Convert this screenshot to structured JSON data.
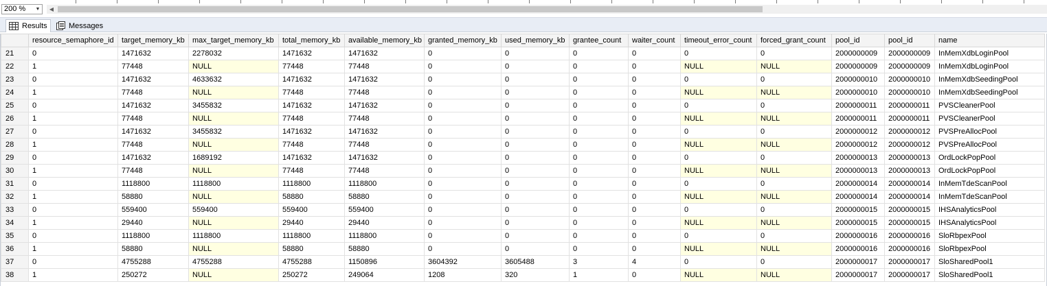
{
  "toolbar": {
    "zoom_value": "200 %"
  },
  "tabs": [
    {
      "label": "Results",
      "icon": "grid-icon",
      "active": true
    },
    {
      "label": "Messages",
      "icon": "messages-icon",
      "active": false
    }
  ],
  "grid": {
    "columns": [
      "resource_semaphore_id",
      "target_memory_kb",
      "max_target_memory_kb",
      "total_memory_kb",
      "available_memory_kb",
      "granted_memory_kb",
      "used_memory_kb",
      "grantee_count",
      "waiter_count",
      "timeout_error_count",
      "forced_grant_count",
      "pool_id",
      "pool_id",
      "name"
    ],
    "null_color": "#ffffe1",
    "rows": [
      [
        "21",
        "0",
        "1471632",
        "2278032",
        "1471632",
        "1471632",
        "0",
        "0",
        "0",
        "0",
        "0",
        "0",
        "2000000009",
        "2000000009",
        "InMemXdbLoginPool"
      ],
      [
        "22",
        "1",
        "77448",
        "NULL",
        "77448",
        "77448",
        "0",
        "0",
        "0",
        "0",
        "NULL",
        "NULL",
        "2000000009",
        "2000000009",
        "InMemXdbLoginPool"
      ],
      [
        "23",
        "0",
        "1471632",
        "4633632",
        "1471632",
        "1471632",
        "0",
        "0",
        "0",
        "0",
        "0",
        "0",
        "2000000010",
        "2000000010",
        "InMemXdbSeedingPool"
      ],
      [
        "24",
        "1",
        "77448",
        "NULL",
        "77448",
        "77448",
        "0",
        "0",
        "0",
        "0",
        "NULL",
        "NULL",
        "2000000010",
        "2000000010",
        "InMemXdbSeedingPool"
      ],
      [
        "25",
        "0",
        "1471632",
        "3455832",
        "1471632",
        "1471632",
        "0",
        "0",
        "0",
        "0",
        "0",
        "0",
        "2000000011",
        "2000000011",
        "PVSCleanerPool"
      ],
      [
        "26",
        "1",
        "77448",
        "NULL",
        "77448",
        "77448",
        "0",
        "0",
        "0",
        "0",
        "NULL",
        "NULL",
        "2000000011",
        "2000000011",
        "PVSCleanerPool"
      ],
      [
        "27",
        "0",
        "1471632",
        "3455832",
        "1471632",
        "1471632",
        "0",
        "0",
        "0",
        "0",
        "0",
        "0",
        "2000000012",
        "2000000012",
        "PVSPreAllocPool"
      ],
      [
        "28",
        "1",
        "77448",
        "NULL",
        "77448",
        "77448",
        "0",
        "0",
        "0",
        "0",
        "NULL",
        "NULL",
        "2000000012",
        "2000000012",
        "PVSPreAllocPool"
      ],
      [
        "29",
        "0",
        "1471632",
        "1689192",
        "1471632",
        "1471632",
        "0",
        "0",
        "0",
        "0",
        "0",
        "0",
        "2000000013",
        "2000000013",
        "OrdLockPopPool"
      ],
      [
        "30",
        "1",
        "77448",
        "NULL",
        "77448",
        "77448",
        "0",
        "0",
        "0",
        "0",
        "NULL",
        "NULL",
        "2000000013",
        "2000000013",
        "OrdLockPopPool"
      ],
      [
        "31",
        "0",
        "1118800",
        "1118800",
        "1118800",
        "1118800",
        "0",
        "0",
        "0",
        "0",
        "0",
        "0",
        "2000000014",
        "2000000014",
        "InMemTdeScanPool"
      ],
      [
        "32",
        "1",
        "58880",
        "NULL",
        "58880",
        "58880",
        "0",
        "0",
        "0",
        "0",
        "NULL",
        "NULL",
        "2000000014",
        "2000000014",
        "InMemTdeScanPool"
      ],
      [
        "33",
        "0",
        "559400",
        "559400",
        "559400",
        "559400",
        "0",
        "0",
        "0",
        "0",
        "0",
        "0",
        "2000000015",
        "2000000015",
        "IHSAnalyticsPool"
      ],
      [
        "34",
        "1",
        "29440",
        "NULL",
        "29440",
        "29440",
        "0",
        "0",
        "0",
        "0",
        "NULL",
        "NULL",
        "2000000015",
        "2000000015",
        "IHSAnalyticsPool"
      ],
      [
        "35",
        "0",
        "1118800",
        "1118800",
        "1118800",
        "1118800",
        "0",
        "0",
        "0",
        "0",
        "0",
        "0",
        "2000000016",
        "2000000016",
        "SloRbpexPool"
      ],
      [
        "36",
        "1",
        "58880",
        "NULL",
        "58880",
        "58880",
        "0",
        "0",
        "0",
        "0",
        "NULL",
        "NULL",
        "2000000016",
        "2000000016",
        "SloRbpexPool"
      ],
      [
        "37",
        "0",
        "4755288",
        "4755288",
        "4755288",
        "1150896",
        "3604392",
        "3605488",
        "3",
        "4",
        "0",
        "0",
        "2000000017",
        "2000000017",
        "SloSharedPool1"
      ],
      [
        "38",
        "1",
        "250272",
        "NULL",
        "250272",
        "249064",
        "1208",
        "320",
        "1",
        "0",
        "NULL",
        "NULL",
        "2000000017",
        "2000000017",
        "SloSharedPool1"
      ]
    ]
  }
}
